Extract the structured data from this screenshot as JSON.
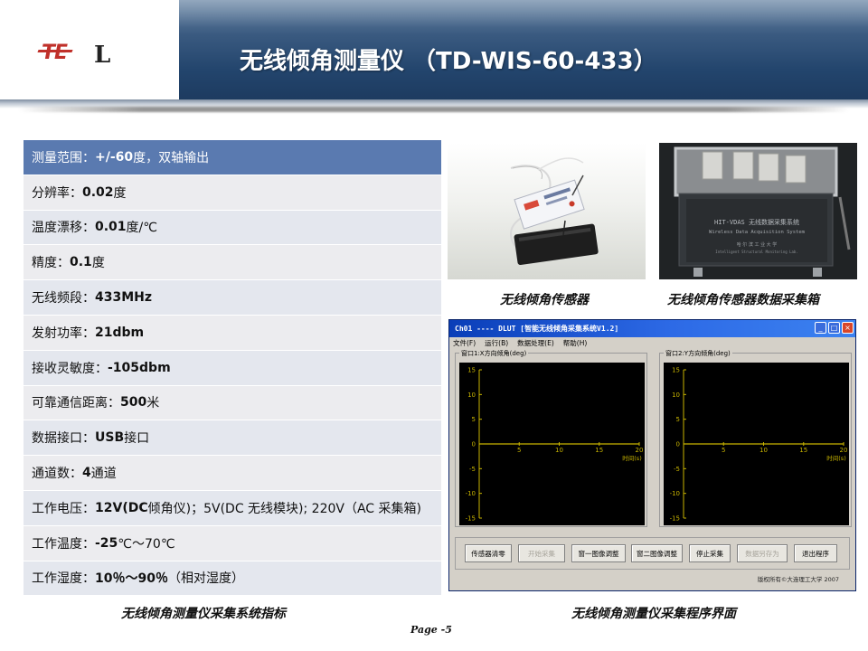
{
  "slide": {
    "title": "无线倾角测量仪 （TD-WIS-60-433）",
    "logo_text": "TEL",
    "page_number": "Page -5"
  },
  "colors": {
    "banner": "#23456d",
    "header_row": "#5a7ab0",
    "logo_red": "#c0302a",
    "plot_bg": "#000000",
    "trace": "#c8b400"
  },
  "specs": [
    {
      "label": "测量范围：",
      "value": "+/-60",
      "suffix": "度，双轴输出"
    },
    {
      "label": "分辨率：",
      "value": "0.02",
      "suffix": "度"
    },
    {
      "label": "温度漂移：",
      "value": "0.01",
      "suffix": "度/℃"
    },
    {
      "label": "精度：",
      "value": "0.1",
      "suffix": "度"
    },
    {
      "label": "无线频段：",
      "value": "433MHz",
      "suffix": ""
    },
    {
      "label": "发射功率：",
      "value": "21dbm",
      "suffix": ""
    },
    {
      "label": "接收灵敏度：",
      "value": "-105dbm",
      "suffix": ""
    },
    {
      "label": "可靠通信距离：",
      "value": "500",
      "suffix": "米"
    },
    {
      "label": "数据接口：",
      "value": "USB",
      "suffix": "接口"
    },
    {
      "label": "通道数：",
      "value": "4",
      "suffix": "通道"
    },
    {
      "label": "工作电压：",
      "value": "12V(DC",
      "suffix": " 倾角仪)；5V(DC 无线模块); 220V（AC 采集箱)"
    },
    {
      "label": "工作温度：",
      "value": "-25",
      "suffix": "℃～70℃"
    },
    {
      "label": "工作湿度：",
      "value": "10％～90％",
      "suffix": "（相对湿度）"
    }
  ],
  "captions": {
    "sensor": "无线倾角传感器",
    "daq_box": "无线倾角传感器数据采集箱",
    "spec_table": "无线倾角测量仪采集系统指标",
    "software": "无线倾角测量仪采集程序界面"
  },
  "photo2": {
    "panel_title": "HIT-VDAS 无线数据采集系统",
    "panel_sub": "Wireless Data Acquisition System",
    "panel_org": "哈 尔 滨 工 业 大 学",
    "panel_org_en": "Intelligent Structural Monitoring Lab."
  },
  "software": {
    "window_title": "Ch01 ---- DLUT [智能无线倾角采集系统V1.2]",
    "menus": [
      "文件(F)",
      "运行(B)",
      "数据处理(E)",
      "帮助(H)"
    ],
    "panel1_label": "窗口1:X方向倾角(deg)",
    "panel2_label": "窗口2:Y方向倾角(deg)",
    "x_axis_label": "时间(s)",
    "buttons": [
      {
        "label": "传感器清零",
        "enabled": true
      },
      {
        "label": "开始采集",
        "enabled": false
      },
      {
        "label": "窗一图像调整",
        "enabled": true
      },
      {
        "label": "窗二图像调整",
        "enabled": true
      },
      {
        "label": "停止采集",
        "enabled": true
      },
      {
        "label": "数据另存为",
        "enabled": false
      },
      {
        "label": "退出程序",
        "enabled": true
      }
    ],
    "copyright": "版权所有©大连理工大学 2007"
  },
  "chart_data": [
    {
      "type": "line",
      "title": "窗口1:X方向倾角(deg)",
      "xlabel": "时间(s)",
      "ylabel": "",
      "xlim": [
        0,
        20
      ],
      "ylim": [
        -15,
        15
      ],
      "x_ticks": [
        5,
        10,
        15,
        20
      ],
      "y_ticks": [
        15,
        10,
        5,
        0,
        -5,
        -10,
        -15
      ],
      "series": [
        {
          "x": [
            0,
            20
          ],
          "y": [
            0,
            0
          ]
        }
      ]
    },
    {
      "type": "line",
      "title": "窗口2:Y方向倾角(deg)",
      "xlabel": "时间(s)",
      "ylabel": "",
      "xlim": [
        0,
        20
      ],
      "ylim": [
        -15,
        15
      ],
      "x_ticks": [
        5,
        10,
        15,
        20
      ],
      "y_ticks": [
        15,
        10,
        5,
        0,
        -5,
        -10,
        -15
      ],
      "series": [
        {
          "x": [
            0,
            20
          ],
          "y": [
            0,
            0
          ]
        }
      ]
    }
  ]
}
